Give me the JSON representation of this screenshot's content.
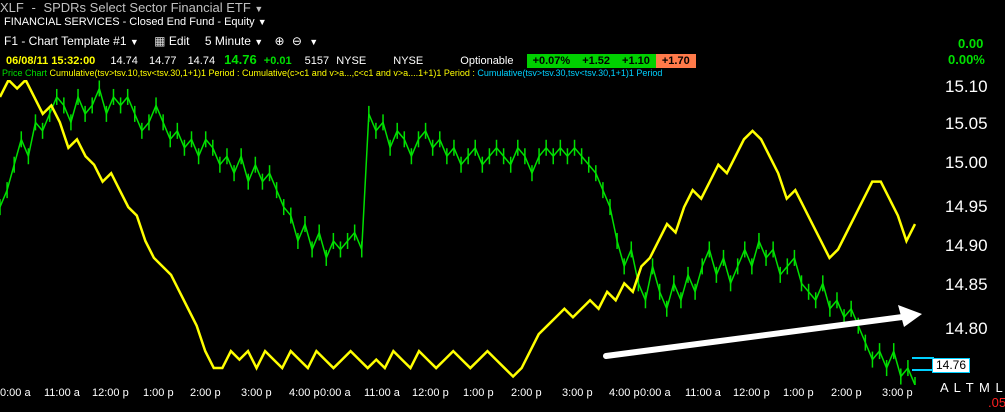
{
  "title": {
    "symbol": "XLF",
    "sep": "-",
    "name": "SPDRs Select Sector Financial ETF"
  },
  "subtitle": "FINANCIAL SERVICES - Closed End Fund - Equity",
  "toolbar": {
    "template": "F1 - Chart Template #1",
    "edit": "Edit",
    "interval": "5 Minute"
  },
  "quote": {
    "datetime": "06/08/11 15:32:00",
    "open": "14.74",
    "high": "14.77",
    "low": "14.74",
    "last": "14.76",
    "change": "+0.01",
    "volume": "5157",
    "exchange1": "NYSE",
    "exchange2": "NYSE",
    "optionable": "Optionable",
    "badges": [
      "+0.07%",
      "+1.52",
      "+1.10",
      "+1.70"
    ]
  },
  "right_stats": {
    "change": "0.00",
    "pct": "0.00%"
  },
  "study_legend": {
    "prefix": "Price Chart",
    "part1": "Cumulative(tsv>tsv.10,tsv<tsv.30,1+1)1 Period : Cumulative(c>c1 and v>a...,c<c1 and v>a....1+1)1 Period : ",
    "part2": "Cumulative(tsv>tsv.30,tsv<tsv.30,1+1)1 Period"
  },
  "price_axis": [
    "15.10",
    "15.05",
    "15.00",
    "14.95",
    "14.90",
    "14.85",
    "14.80"
  ],
  "last_price_label": "14.76",
  "time_axis": [
    "0:00 a",
    "11:00 a",
    "12:00 p",
    "1:00 p",
    "2:00 p",
    "3:00 p",
    "4:00 p",
    "0:00 a",
    "11:00 a",
    "12:00 p",
    "1:00 p",
    "2:00 p",
    "3:00 p",
    "4:00 p",
    "0:00 a",
    "11:00 a",
    "12:00 p",
    "1:00 p",
    "2:00 p",
    "3:00 p"
  ],
  "corner": {
    "letters": "A L T M L",
    "value": ".05"
  },
  "colors": {
    "green": "#00e000",
    "yellow": "#ffff00",
    "cyan": "#00d0ff",
    "red": "#ff2020",
    "arrow": "#ffffff"
  },
  "chart_data": {
    "type": "line",
    "y_axis_range": [
      14.76,
      15.12
    ],
    "series": [
      {
        "values": [
          14.97,
          14.99,
          15.02,
          15.05,
          15.03,
          15.07,
          15.06,
          15.08,
          15.1,
          15.09,
          15.07,
          15.1,
          15.08,
          15.09,
          15.11,
          15.08,
          15.1,
          15.09,
          15.1,
          15.08,
          15.06,
          15.07,
          15.09,
          15.07,
          15.05,
          15.06,
          15.04,
          15.05,
          15.03,
          15.05,
          15.04,
          15.02,
          15.03,
          15.01,
          15.03,
          15.0,
          15.02,
          15.0,
          15.01,
          14.99,
          14.97,
          14.96,
          14.93,
          14.95,
          14.92,
          14.94,
          14.91,
          14.93,
          14.92,
          14.93,
          14.94,
          14.92,
          15.08,
          15.06,
          15.07,
          15.04,
          15.06,
          15.05,
          15.03,
          15.05,
          15.06,
          15.04,
          15.05,
          15.03,
          15.04,
          15.02,
          15.03,
          15.04,
          15.02,
          15.03,
          15.04,
          15.03,
          15.02,
          15.04,
          15.03,
          15.01,
          15.03,
          15.04,
          15.03,
          15.04,
          15.03,
          15.04,
          15.03,
          15.02,
          15.01,
          14.99,
          14.97,
          14.93,
          14.9,
          14.92,
          14.88,
          14.86,
          14.9,
          14.87,
          14.85,
          14.88,
          14.86,
          14.89,
          14.87,
          14.9,
          14.92,
          14.89,
          14.91,
          14.88,
          14.9,
          14.92,
          14.9,
          14.93,
          14.91,
          14.92,
          14.89,
          14.9,
          14.91,
          14.88,
          14.87,
          14.86,
          14.88,
          14.85,
          14.86,
          14.84,
          14.85,
          14.83,
          14.81,
          14.79,
          14.8,
          14.78,
          14.8,
          14.77,
          14.78,
          14.76
        ]
      },
      {
        "values": [
          15.1,
          15.12,
          15.11,
          15.12,
          15.1,
          15.08,
          15.09,
          15.07,
          15.04,
          15.05,
          15.03,
          15.02,
          15.0,
          15.01,
          14.99,
          14.97,
          14.96,
          14.93,
          14.91,
          14.9,
          14.89,
          14.87,
          14.85,
          14.83,
          14.8,
          14.78,
          14.78,
          14.8,
          14.79,
          14.8,
          14.78,
          14.8,
          14.79,
          14.78,
          14.8,
          14.79,
          14.78,
          14.8,
          14.79,
          14.78,
          14.79,
          14.8,
          14.79,
          14.78,
          14.79,
          14.78,
          14.8,
          14.79,
          14.78,
          14.8,
          14.79,
          14.78,
          14.79,
          14.8,
          14.79,
          14.78,
          14.79,
          14.8,
          14.79,
          14.78,
          14.77,
          14.78,
          14.8,
          14.82,
          14.83,
          14.84,
          14.85,
          14.84,
          14.85,
          14.86,
          14.85,
          14.87,
          14.86,
          14.88,
          14.87,
          14.9,
          14.91,
          14.93,
          14.95,
          14.94,
          14.97,
          14.99,
          14.98,
          15.0,
          15.02,
          15.01,
          15.03,
          15.05,
          15.06,
          15.05,
          15.03,
          15.01,
          14.98,
          14.99,
          14.97,
          14.95,
          14.93,
          14.91,
          14.92,
          14.94,
          14.96,
          14.98,
          15.0,
          15.0,
          14.98,
          14.96,
          14.93,
          14.95
        ]
      }
    ]
  }
}
